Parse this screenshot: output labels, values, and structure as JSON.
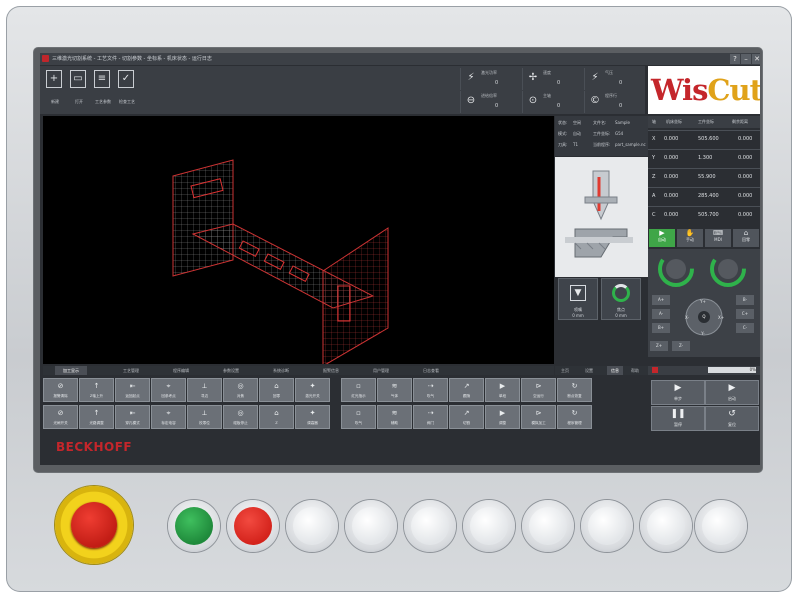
{
  "window": {
    "title": "三维激光切割系统 - 工艺文件 - 切割参数 - 坐标系 - 机床状态 - 运行日志",
    "controls": [
      "?",
      "–",
      "✕"
    ]
  },
  "toolbar": {
    "buttons": [
      {
        "icon": "new-file-icon",
        "label": "新建"
      },
      {
        "icon": "open-folder-icon",
        "label": "打开"
      },
      {
        "icon": "process-list-icon",
        "label": "工艺参数"
      },
      {
        "icon": "process-check-icon",
        "label": "检查工艺"
      }
    ]
  },
  "status": {
    "items": [
      {
        "icon": "laser-icon",
        "label": "激光功率",
        "value": "0"
      },
      {
        "icon": "speed-icon",
        "label": "速度",
        "value": "0"
      },
      {
        "icon": "laser-icon",
        "label": "气压",
        "value": "0"
      },
      {
        "icon": "feed-icon",
        "label": "进给倍率",
        "value": "0"
      },
      {
        "icon": "gauge-icon",
        "label": "主轴",
        "value": "0"
      },
      {
        "icon": "copyright-icon",
        "label": "程序行",
        "value": "0"
      }
    ]
  },
  "brand": {
    "part1": "Wis",
    "part2": "Cut"
  },
  "viewport": {
    "tabs": [
      {
        "label": "加工显示",
        "active": true
      },
      {
        "label": "工艺管理",
        "active": false
      },
      {
        "label": "程序编辑",
        "active": false
      },
      {
        "label": "参数设置",
        "active": false
      },
      {
        "label": "系统诊断",
        "active": false
      },
      {
        "label": "报警信息",
        "active": false
      },
      {
        "label": "用户管理",
        "active": false
      },
      {
        "label": "日志查看",
        "active": false
      }
    ]
  },
  "process_info": {
    "rows": [
      {
        "k1": "状态:",
        "v1": "空闲",
        "k2": "文件名:",
        "v2": "Sample"
      },
      {
        "k1": "模式:",
        "v1": "自动",
        "k2": "工件坐标:",
        "v2": "G54"
      },
      {
        "k1": "刀具:",
        "v1": "T1",
        "k2": "当前程序:",
        "v2": "part_sample.nc"
      }
    ]
  },
  "side_buttons": [
    {
      "icon": "nozzle-icon",
      "label": "喷嘴",
      "value": "0 mm"
    },
    {
      "icon": "power-icon",
      "label": "焦点",
      "value": "0 mm"
    }
  ],
  "coords": {
    "headers": [
      "轴",
      "机床坐标",
      "工件坐标",
      "剩余距离"
    ],
    "rows": [
      {
        "axis": "X",
        "machine": "0.000",
        "work": "505.600",
        "dist": "0.000"
      },
      {
        "axis": "Y",
        "machine": "0.000",
        "work": "1.300",
        "dist": "0.000"
      },
      {
        "axis": "Z",
        "machine": "0.000",
        "work": "55.900",
        "dist": "0.000"
      },
      {
        "axis": "A",
        "machine": "0.000",
        "work": "285.400",
        "dist": "0.000"
      },
      {
        "axis": "C",
        "machine": "0.000",
        "work": "505.700",
        "dist": "0.000"
      }
    ]
  },
  "modes": [
    {
      "label": "自动",
      "active": true
    },
    {
      "label": "手动",
      "active": false
    },
    {
      "label": "MDI",
      "active": false
    },
    {
      "label": "回零",
      "active": false
    }
  ],
  "jog": {
    "keys": [
      "X+",
      "X-",
      "Y+",
      "Y-",
      "Z+",
      "Z-",
      "A+",
      "A-",
      "B+",
      "B-",
      "C+",
      "C-",
      "Q"
    ],
    "bottom_tabs": [
      "主页",
      "设置",
      "信息",
      "帮助"
    ],
    "feed": "0%"
  },
  "op_grid": {
    "row1": [
      "报警清除",
      "Z轴上升",
      "返回起点",
      "回参考点",
      "寻边",
      "对焦",
      "回零",
      "激光开关",
      "红光指示",
      "气体",
      "吹气",
      "跟随",
      "单段",
      "空运行",
      "断点恢复"
    ],
    "row2": [
      "光闸开关",
      "光路调整",
      "穿孔模式",
      "标定电容",
      "校零位",
      "碰板停止",
      "Z",
      "调高器",
      "吹气",
      "辅助",
      "阀门",
      "切割",
      "调整",
      "模拟加工",
      "程序管理"
    ]
  },
  "run_buttons": [
    {
      "icon": "step-icon",
      "label": "单步"
    },
    {
      "icon": "play-icon",
      "label": "启动"
    },
    {
      "icon": "pause-icon",
      "label": "暂停"
    },
    {
      "icon": "reset-icon",
      "label": "复位"
    }
  ],
  "hardware": {
    "brand": "BECKHOFF",
    "buttons": [
      {
        "name": "green-start-button",
        "color": "#1f8a3b"
      },
      {
        "name": "red-stop-button",
        "color": "#d4231c"
      },
      {
        "name": "white-button-1",
        "color": "#ffffff"
      },
      {
        "name": "white-button-2",
        "color": "#ffffff"
      },
      {
        "name": "white-button-3",
        "color": "#ffffff"
      },
      {
        "name": "white-button-4",
        "color": "#ffffff"
      },
      {
        "name": "white-button-5",
        "color": "#ffffff"
      },
      {
        "name": "white-button-6",
        "color": "#ffffff"
      },
      {
        "name": "white-button-7",
        "color": "#ffffff"
      },
      {
        "name": "white-button-8",
        "color": "#ffffff"
      }
    ]
  }
}
